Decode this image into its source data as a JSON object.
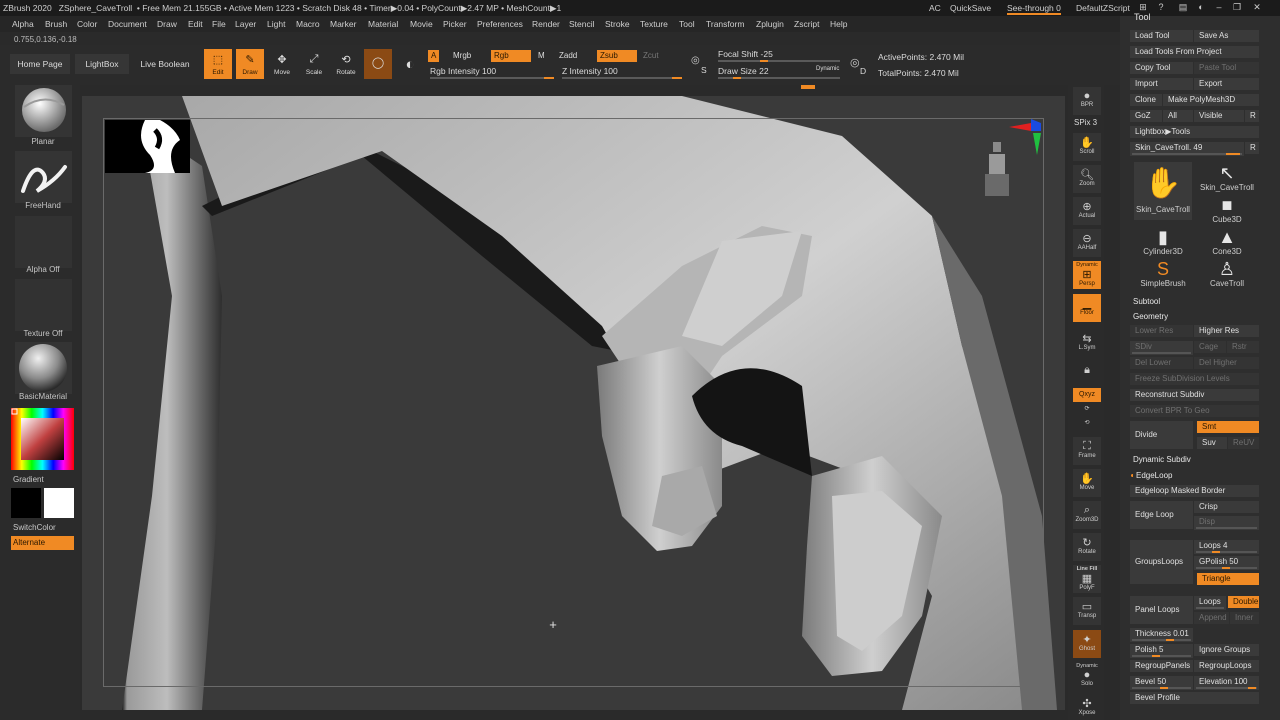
{
  "titlebar": {
    "app": "ZBrush 2020",
    "doc": "ZSphere_CaveTroll",
    "free_mem": "• Free Mem 21.155GB",
    "active_mem": "• Active Mem 1223",
    "scratch": "• Scratch Disk 48",
    "timer": "• Timer▶0.04",
    "polycount": "• PolyCount▶2.47 MP",
    "meshcount": "• MeshCount▶1",
    "ac": "AC",
    "quicksave": "QuickSave",
    "see_through": "See-through  0",
    "default_zscript": "DefaultZScript"
  },
  "menu": [
    "Alpha",
    "Brush",
    "Color",
    "Document",
    "Draw",
    "Edit",
    "File",
    "Layer",
    "Light",
    "Macro",
    "Marker",
    "Material",
    "Movie",
    "Picker",
    "Preferences",
    "Render",
    "Stencil",
    "Stroke",
    "Texture",
    "Tool",
    "Transform",
    "Zplugin",
    "Zscript",
    "Help"
  ],
  "coords": "0.755,0.136,-0.18",
  "shelf": {
    "home": "Home Page",
    "lightbox": "LightBox",
    "live_boolean": "Live Boolean",
    "edit": "Edit",
    "draw": "Draw",
    "move": "Move",
    "scale": "Scale",
    "rotate": "Rotate",
    "a": "A",
    "mrgb": "Mrgb",
    "rgb": "Rgb",
    "m": "M",
    "zadd": "Zadd",
    "zsub": "Zsub",
    "zcut": "Zcut",
    "rgb_intensity": "Rgb Intensity 100",
    "z_intensity": "Z Intensity 100",
    "focal_shift": "Focal Shift -25",
    "draw_size": "Draw Size 22",
    "dynamic": "Dynamic",
    "active_points": "ActivePoints: 2.470 Mil",
    "total_points": "TotalPoints: 2.470 Mil",
    "s": "S",
    "d": "D"
  },
  "left": {
    "planar": "Planar",
    "freehand": "FreeHand",
    "alpha_off": "Alpha Off",
    "texture_off": "Texture Off",
    "basic_material": "BasicMaterial",
    "gradient": "Gradient",
    "switch_color": "SwitchColor",
    "alternate": "Alternate"
  },
  "right": {
    "bpr": "BPR",
    "spix": "SPix 3",
    "scroll": "Scroll",
    "zoom": "Zoom",
    "actual": "Actual",
    "aahalf": "AAHalf",
    "dynamic": "Dynamic",
    "persp": "Persp",
    "floor": "Floor",
    "lsym": "L.Sym",
    "xyz": "Qxyz",
    "frame": "Frame",
    "move": "Move",
    "zoom3d": "Zoom3D",
    "rotate": "Rotate",
    "line_fill": "Line Fill",
    "polyf": "PolyF",
    "transp": "Transp",
    "ghost": "Ghost",
    "solo": "Solo",
    "xpose": "Xpose"
  },
  "tool": {
    "header": "Tool",
    "load_tool": "Load Tool",
    "save_as": "Save As",
    "load_from_project": "Load Tools From Project",
    "copy_tool": "Copy Tool",
    "paste_tool": "Paste Tool",
    "import": "Import",
    "export": "Export",
    "clone": "Clone",
    "make_polymesh": "Make PolyMesh3D",
    "goz": "GoZ",
    "all": "All",
    "visible": "Visible",
    "r": "R",
    "lightbox_tools": "Lightbox▶Tools",
    "current_tool": "Skin_CaveTroll. 49",
    "thumbs": [
      {
        "label": "Skin_CaveTroll",
        "icon": "hand-mesh-icon"
      },
      {
        "label": "Skin_CaveTroll",
        "icon": "cursor-icon"
      },
      {
        "label": "Cube3D",
        "icon": "cube-icon"
      },
      {
        "label": "Cylinder3D",
        "icon": "cylinder-icon"
      },
      {
        "label": "Cone3D",
        "icon": "cone-icon"
      },
      {
        "label": "SimpleBrush",
        "icon": "simplebrush-icon"
      },
      {
        "label": "CaveTroll",
        "icon": "figure-icon"
      }
    ],
    "subtool": "Subtool",
    "geometry": "Geometry",
    "lower_res": "Lower Res",
    "higher_res": "Higher Res",
    "sdiv": "SDiv",
    "cage": "Cage",
    "rstr": "Rstr",
    "del_lower": "Del Lower",
    "del_higher": "Del Higher",
    "freeze_subdiv": "Freeze SubDivision Levels",
    "reconstruct": "Reconstruct Subdiv",
    "convert_bpr": "Convert BPR To Geo",
    "divide": "Divide",
    "smt": "Smt",
    "suv": "Suv",
    "reuv": "ReUV",
    "dynamic_subdiv": "Dynamic Subdiv",
    "edgeloop": "EdgeLoop",
    "edgeloop_masked": "Edgeloop Masked Border",
    "edge_loop": "Edge Loop",
    "crisp": "Crisp",
    "disp": "Disp",
    "groups_loops": "GroupsLoops",
    "loops": "Loops 4",
    "gpolish": "GPolish 50",
    "triangle": "Triangle",
    "panel_loops": "Panel Loops",
    "loops2": "Loops",
    "double": "Double",
    "append": "Append",
    "inner": "Inner",
    "thickness": "Thickness 0.01",
    "polish": "Polish 5",
    "ignore_groups": "Ignore Groups",
    "regroup_panels": "RegroupPanels",
    "regroup_loops": "RegroupLoops",
    "bevel": "Bevel 50",
    "elevation": "Elevation 100",
    "bevel_profile": "Bevel Profile"
  },
  "colors": {
    "accent": "#f08a24",
    "panel": "#2e2e2e",
    "canvas": "#3a3a3a"
  }
}
